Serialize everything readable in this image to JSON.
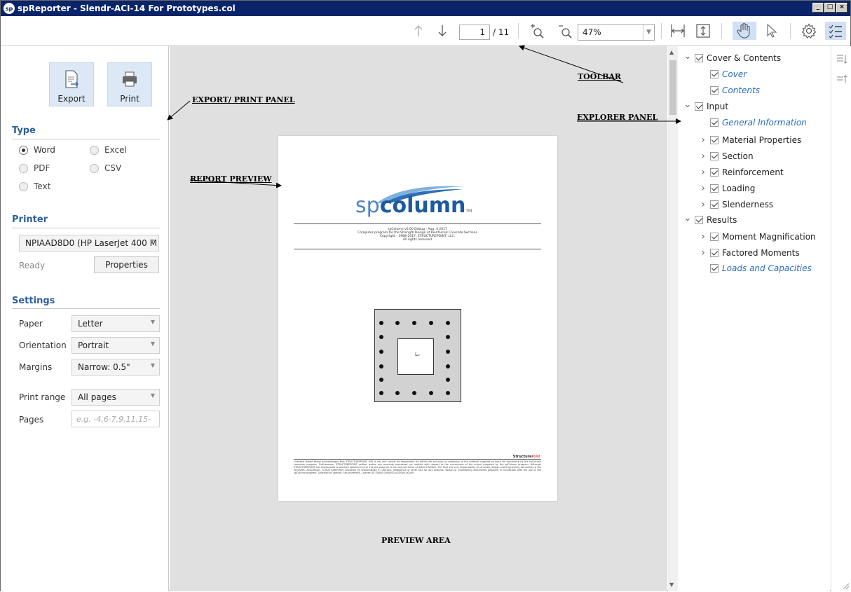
{
  "window": {
    "app_icon": "sp",
    "title": "spReporter - Slendr-ACI-14 For Prototypes.col",
    "buttons": [
      "_",
      "□",
      "×"
    ]
  },
  "toolbar": {
    "page_current": "1",
    "page_total": "/ 11",
    "zoom": "47%",
    "icons": [
      "arrow-up-icon",
      "arrow-down-icon",
      "zoom-in-icon",
      "zoom-out-icon",
      "fit-width-icon",
      "fit-page-icon",
      "hand-icon",
      "pointer-icon",
      "gear-icon",
      "explorer-toggle-icon"
    ]
  },
  "export_print": {
    "export_label": "Export",
    "print_label": "Print"
  },
  "type_section": {
    "title": "Type",
    "options": [
      {
        "label": "Word",
        "selected": true
      },
      {
        "label": "Excel",
        "selected": false
      },
      {
        "label": "PDF",
        "selected": false
      },
      {
        "label": "CSV",
        "selected": false
      },
      {
        "label": "Text",
        "selected": false
      }
    ]
  },
  "printer_section": {
    "title": "Printer",
    "printer": "NPIAAD8D0 (HP LaserJet 400 M",
    "status": "Ready",
    "properties_label": "Properties"
  },
  "settings_section": {
    "title": "Settings",
    "paper_label": "Paper",
    "paper_value": "Letter",
    "orientation_label": "Orientation",
    "orientation_value": "Portrait",
    "margins_label": "Margins",
    "margins_value": "Narrow: 0.5\"",
    "print_range_label": "Print range",
    "print_range_value": "All pages",
    "pages_label": "Pages",
    "pages_placeholder": "e.g. -4,6-7,9,11,15-"
  },
  "preview": {
    "logo_sp": "sp",
    "logo_column": "column",
    "logo_tm": "TM",
    "header_lines": [
      "spColumn v6.00 Debug - Aug. 4 2017",
      "Computer program for the Strength Design of Reinforced Concrete Sections",
      "Copyright - 1988-2017, STRUCTUREPOINT, LLC.",
      "All rights reserved"
    ],
    "axis_marker": "Lₓ",
    "footer_brand": "Structure",
    "footer_brand_accent": "Point",
    "footer_text": "Licensee stated below acknowledges that STRUCTUREPOINT (SP) is not and cannot be responsible for either the accuracy or adequacy of the material supplied as input for processing by the spColumn computer program. Furthermore, STRUCTUREPOINT neither makes any warranty expressed nor implied with respect to the correctness of the output prepared by the spColumn program. Although STRUCTUREPOINT has endeavored to produce spColumn error free the program is not and cannot be certified infallible. The final and only responsibility for analysis, design and engineering documents is the licensees. Accordingly, STRUCTUREPOINT disclaims all responsibility in contract, negligence or other tort for any analysis, design or engineering documents prepared in connection with the use of the spColumn program. Licensed to: speceb, StructurePoint. License ID: 00000-0000000-0-00000-00000"
  },
  "annotations": {
    "toolbar": "TOOLBAR",
    "export_print": "EXPORT/ PRINT PANEL",
    "report_preview": "REPORT PREVIEW",
    "explorer": "EXPLORER PANEL",
    "preview_area": "PREVIEW AREA"
  },
  "explorer": {
    "nodes": [
      {
        "label": "Cover & Contents",
        "level": 0,
        "toggle": "expanded",
        "link": false
      },
      {
        "label": "Cover",
        "level": 1,
        "toggle": "none",
        "link": true
      },
      {
        "label": "Contents",
        "level": 1,
        "toggle": "none",
        "link": true
      },
      {
        "label": "Input",
        "level": 0,
        "toggle": "expanded",
        "link": false
      },
      {
        "label": "General Information",
        "level": 1,
        "toggle": "none",
        "link": true
      },
      {
        "label": "Material Properties",
        "level": 1,
        "toggle": "collapsed",
        "link": false
      },
      {
        "label": "Section",
        "level": 1,
        "toggle": "collapsed",
        "link": false
      },
      {
        "label": "Reinforcement",
        "level": 1,
        "toggle": "collapsed",
        "link": false
      },
      {
        "label": "Loading",
        "level": 1,
        "toggle": "collapsed",
        "link": false
      },
      {
        "label": "Slenderness",
        "level": 1,
        "toggle": "collapsed",
        "link": false
      },
      {
        "label": "Results",
        "level": 0,
        "toggle": "expanded",
        "link": false
      },
      {
        "label": "Moment Magnification",
        "level": 1,
        "toggle": "collapsed",
        "link": false
      },
      {
        "label": "Factored Moments",
        "level": 1,
        "toggle": "collapsed",
        "link": false
      },
      {
        "label": "Loads and Capacities",
        "level": 1,
        "toggle": "none",
        "link": true
      }
    ]
  }
}
